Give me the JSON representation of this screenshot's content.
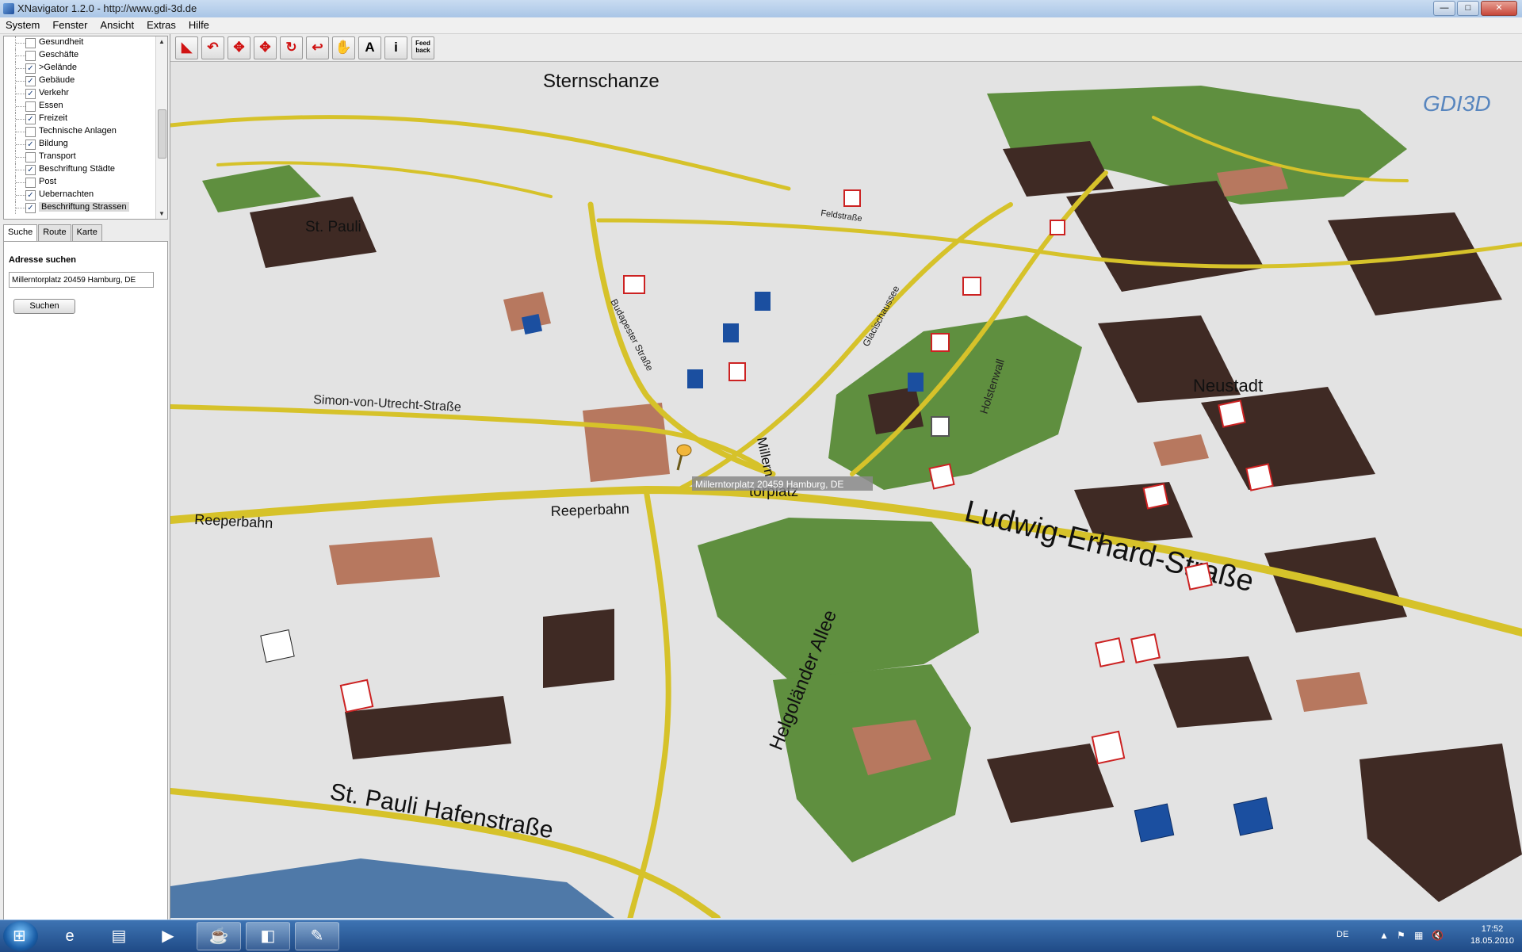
{
  "window": {
    "title": "XNavigator 1.2.0 - http://www.gdi-3d.de",
    "controls": [
      "—",
      "□",
      "✕"
    ]
  },
  "menubar": [
    "System",
    "Fenster",
    "Ansicht",
    "Extras",
    "Hilfe"
  ],
  "layers": [
    {
      "label": "Gesundheit",
      "checked": false
    },
    {
      "label": "Geschäfte",
      "checked": false
    },
    {
      "label": ">Gelände",
      "checked": true
    },
    {
      "label": "Gebäude",
      "checked": true
    },
    {
      "label": "Verkehr",
      "checked": true
    },
    {
      "label": "Essen",
      "checked": false
    },
    {
      "label": "Freizeit",
      "checked": true
    },
    {
      "label": "Technische Anlagen",
      "checked": false
    },
    {
      "label": "Bildung",
      "checked": true
    },
    {
      "label": "Transport",
      "checked": false
    },
    {
      "label": "Beschriftung Städte",
      "checked": true
    },
    {
      "label": "Post",
      "checked": false
    },
    {
      "label": "Uebernachten",
      "checked": true
    },
    {
      "label": "Beschriftung Strassen",
      "checked": true,
      "selected": true
    }
  ],
  "tabs": [
    {
      "label": "Suche",
      "active": true
    },
    {
      "label": "Route",
      "active": false
    },
    {
      "label": "Karte",
      "active": false
    }
  ],
  "search": {
    "heading": "Adresse suchen",
    "value": "Millerntorplatz 20459 Hamburg, DE",
    "button": "Suchen"
  },
  "toolbar": {
    "buttons": [
      {
        "name": "move-forward-tool",
        "glyph": "◣",
        "red": true
      },
      {
        "name": "tilt-tool",
        "glyph": "↶",
        "red": true
      },
      {
        "name": "pan-tool",
        "glyph": "✥",
        "red": true
      },
      {
        "name": "pan-alt-tool",
        "glyph": "✥",
        "red": true
      },
      {
        "name": "rotate-tool",
        "glyph": "↻",
        "red": true
      },
      {
        "name": "turn-tool",
        "glyph": "↩",
        "red": true
      },
      {
        "name": "hand-tool",
        "glyph": "✋",
        "red": false
      },
      {
        "name": "annotation-tool",
        "glyph": "A",
        "red": false
      },
      {
        "name": "info-tool",
        "glyph": "i",
        "red": false
      }
    ],
    "feedback_label": "Feed back"
  },
  "map": {
    "logo": "GDI3D",
    "marker_label": "Millerntorplatz 20459 Hamburg, DE",
    "districts": [
      "Sternschanze",
      "St. Pauli",
      "Neustadt"
    ],
    "streets": [
      "Simon-von-Utrecht-Straße",
      "Reeperbahn",
      "Reeperbahn",
      "Millern",
      "torplatz",
      "Ludwig-Erhard-Straße",
      "Helgoländer Allee",
      "St. Pauli Hafenstraße",
      "Feldstraße",
      "Budapester Straße",
      "Glacischaussee",
      "Holstenwall"
    ],
    "colors": {
      "ground": "#e3e3e3",
      "park": "#5f8f3f",
      "road": "#d6c22a",
      "building_dark": "#3f2a24",
      "building_red": "#b7785f",
      "water": "#4f79a8"
    }
  },
  "taskbar": {
    "tray": {
      "language": "DE",
      "time": "17:52",
      "date": "18.05.2010"
    }
  }
}
